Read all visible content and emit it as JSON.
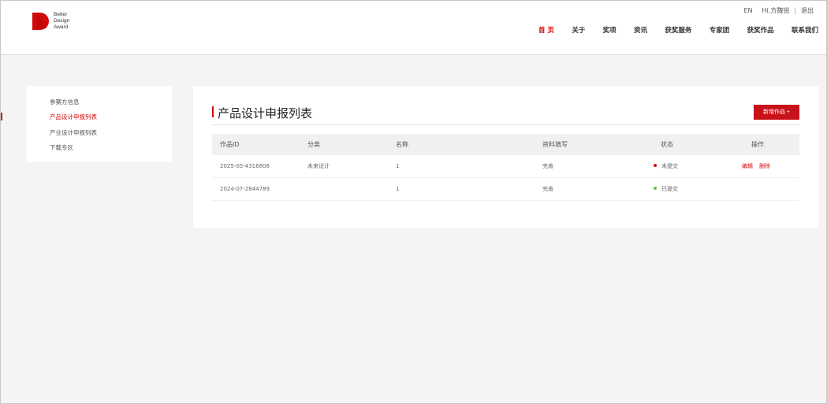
{
  "brand": {
    "name_line1": "Better",
    "name_line2": "Design",
    "name_line3": "Award",
    "accent_color": "#d40a0a"
  },
  "topbar": {
    "lang": "EN",
    "greeting": "Hi,方魏锐",
    "divider": "|",
    "logout": "退出"
  },
  "nav": [
    {
      "label": "首 页",
      "active": true
    },
    {
      "label": "关于"
    },
    {
      "label": "奖项"
    },
    {
      "label": "资讯"
    },
    {
      "label": "获奖服务"
    },
    {
      "label": "专家团"
    },
    {
      "label": "获奖作品"
    },
    {
      "label": "联系我们"
    }
  ],
  "sidebar": {
    "items": [
      {
        "label": "参赛方信息"
      },
      {
        "label": "产品设计申报列表",
        "active": true
      },
      {
        "label": "产业设计申报列表"
      },
      {
        "label": "下载专区"
      }
    ]
  },
  "main": {
    "title": "产品设计申报列表",
    "new_button": "新增作品 +"
  },
  "table": {
    "headers": {
      "id": "作品ID",
      "category": "分类",
      "name": "名称",
      "docs": "资料填写",
      "status": "状态",
      "ops": "操作"
    },
    "rows": [
      {
        "id": "2025-05-4316808",
        "category": "未来设计",
        "name": "1",
        "docs": "完善",
        "status": "未提交",
        "status_color": "#d40a0a",
        "edit": "编辑",
        "delete": "删除"
      },
      {
        "id": "2024-07-2844789",
        "category": "",
        "name": "1",
        "docs": "完善",
        "status": "已提交",
        "status_color": "#6cc04a"
      }
    ]
  }
}
